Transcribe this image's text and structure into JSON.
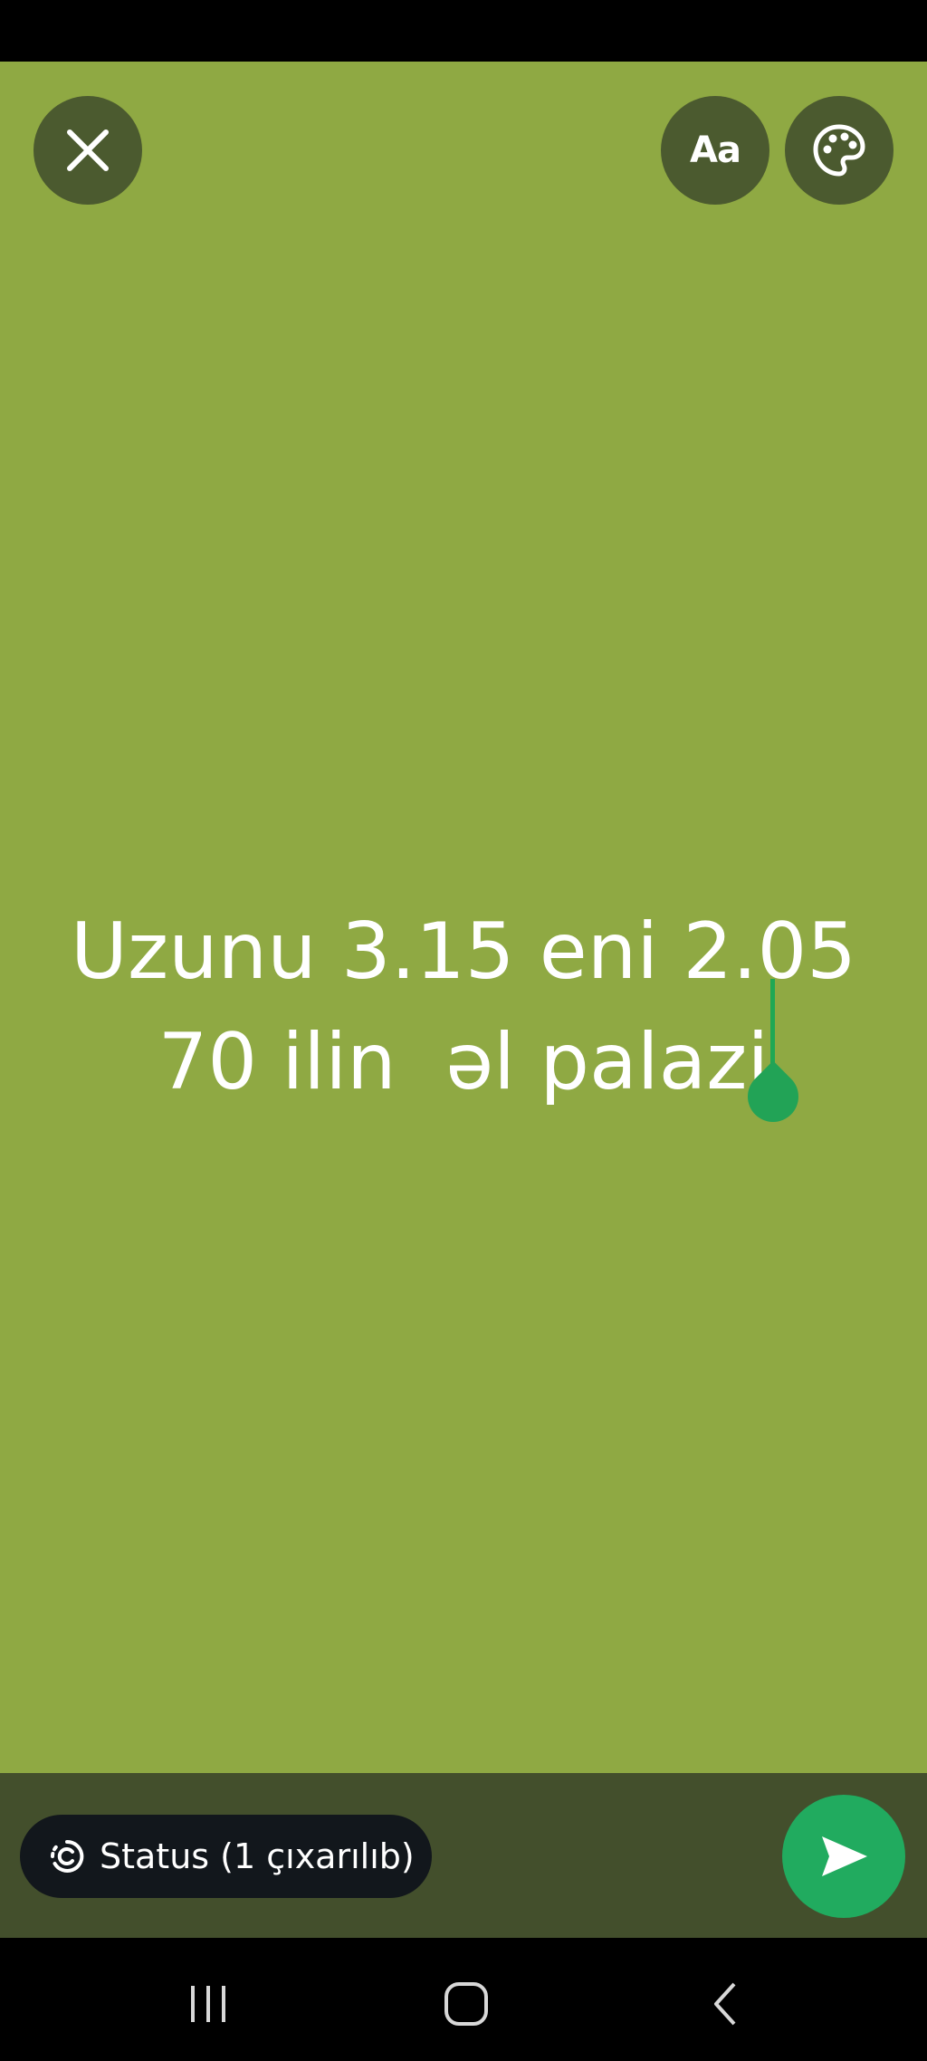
{
  "app": {
    "screen": "status-text-composer"
  },
  "colors": {
    "background": "#8fa943",
    "button_background": "#4b5a2f",
    "bottom_bar": "#434f2c",
    "chip_background": "#12171c",
    "accent_green": "#21ab5f"
  },
  "toolbar": {
    "close_icon": "close-icon",
    "font_label": "Aa",
    "palette_icon": "palette-icon"
  },
  "status": {
    "line1": "Uzunu 3.15 eni 2.05",
    "line2": "70 ilin  əl palazi"
  },
  "bottom": {
    "audience_label": "Status (1 çıxarılıb)",
    "audience_icon": "status-ring-icon",
    "send_icon": "send-icon"
  },
  "navigation": {
    "recents_icon": "recents-icon",
    "home_icon": "home-icon",
    "back_icon": "back-icon"
  }
}
